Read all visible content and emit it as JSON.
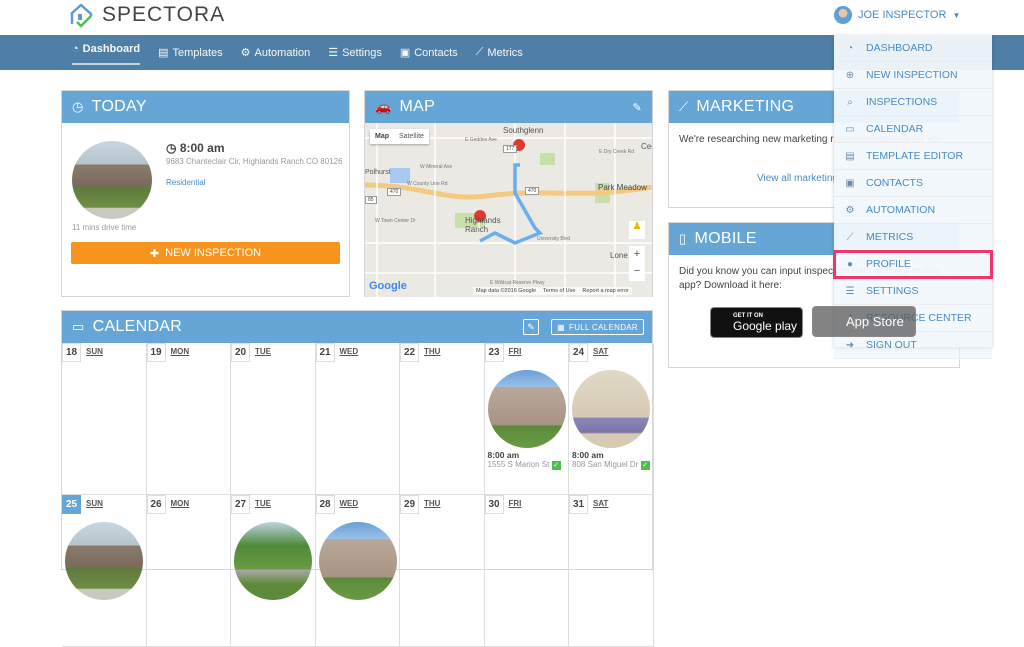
{
  "brand": "SPECTORA",
  "user": {
    "name": "JOE INSPECTOR"
  },
  "nav": [
    {
      "label": "Dashboard",
      "icon": "dashboard-icon"
    },
    {
      "label": "Templates",
      "icon": "templates-icon"
    },
    {
      "label": "Automation",
      "icon": "gears-icon"
    },
    {
      "label": "Settings",
      "icon": "sliders-icon"
    },
    {
      "label": "Contacts",
      "icon": "contact-card-icon"
    },
    {
      "label": "Metrics",
      "icon": "chart-icon"
    }
  ],
  "today": {
    "title": "TODAY",
    "time": "8:00 am",
    "address": "9683 Chanteclair Cir, Highlands Ranch CO 80126",
    "type": "Residential",
    "drive": "11 mins drive time",
    "button": "NEW INSPECTION"
  },
  "map": {
    "title": "MAP",
    "tab_map": "Map",
    "tab_satellite": "Satellite",
    "labels": {
      "southglenn": "Southglenn",
      "park": "Park Meadow",
      "highlands": "Highlands Ranch",
      "polhurst": "Polhurst",
      "lone": "Lone",
      "cen": "Cen",
      "geddes": "E Geddes Ave",
      "mineral": "W Mineral Ave",
      "county": "W County Line Rd",
      "drycreek": "E Dry Creek Rd",
      "towncenter": "W Town Center Dr",
      "wildcat": "E Wildcat Reserve Pkwy",
      "univ": "University Blvd",
      "r470": "470",
      "r177": "177",
      "r85": "85"
    },
    "marker": "1",
    "footer_data": "Map data ©2016 Google",
    "footer_terms": "Terms of Use",
    "footer_report": "Report a map error",
    "google": "Google",
    "zoom_in": "+",
    "zoom_out": "−"
  },
  "marketing": {
    "title": "MARKETING",
    "text": "We're researching new marketing recommendations for you.",
    "link": "View all marketing"
  },
  "mobile": {
    "title": "MOBILE",
    "text": "Did you know you can input inspection data with our mobile app? Download it here:",
    "google_small": "GET IT ON",
    "google_big": "Google play",
    "apple_big": "App Store"
  },
  "calendar": {
    "title": "CALENDAR",
    "full": "FULL CALENDAR",
    "days": [
      {
        "n": "18",
        "d": "SUN"
      },
      {
        "n": "19",
        "d": "MON"
      },
      {
        "n": "20",
        "d": "TUE"
      },
      {
        "n": "21",
        "d": "WED"
      },
      {
        "n": "22",
        "d": "THU"
      },
      {
        "n": "23",
        "d": "FRI",
        "time": "8:00 am",
        "addr": "1555 S Marion St"
      },
      {
        "n": "24",
        "d": "SAT",
        "time": "8:00 am",
        "addr": "808 San Miguel Dr"
      },
      {
        "n": "25",
        "d": "SUN",
        "today": true
      },
      {
        "n": "26",
        "d": "MON"
      },
      {
        "n": "27",
        "d": "TUE"
      },
      {
        "n": "28",
        "d": "WED"
      },
      {
        "n": "29",
        "d": "THU"
      },
      {
        "n": "30",
        "d": "FRI"
      },
      {
        "n": "31",
        "d": "SAT"
      }
    ]
  },
  "dropdown": [
    {
      "label": "DASHBOARD",
      "icon": "dashboard-icon"
    },
    {
      "label": "NEW INSPECTION",
      "icon": "plus-circle-icon"
    },
    {
      "label": "INSPECTIONS",
      "icon": "search-icon"
    },
    {
      "label": "CALENDAR",
      "icon": "calendar-icon"
    },
    {
      "label": "TEMPLATE EDITOR",
      "icon": "templates-icon"
    },
    {
      "label": "CONTACTS",
      "icon": "contact-card-icon"
    },
    {
      "label": "AUTOMATION",
      "icon": "gears-icon"
    },
    {
      "label": "METRICS",
      "icon": "chart-icon"
    },
    {
      "label": "PROFILE",
      "icon": "user-icon"
    },
    {
      "label": "SETTINGS",
      "icon": "sliders-icon"
    },
    {
      "label": "RESOURCE CENTER",
      "icon": "key-icon"
    },
    {
      "label": "SIGN OUT",
      "icon": "sign-out-icon"
    }
  ],
  "colors": {
    "nav": "#4f7fa6",
    "panel_header": "#66a6d6",
    "accent_orange": "#f7941d",
    "highlight": "#f0356b"
  }
}
